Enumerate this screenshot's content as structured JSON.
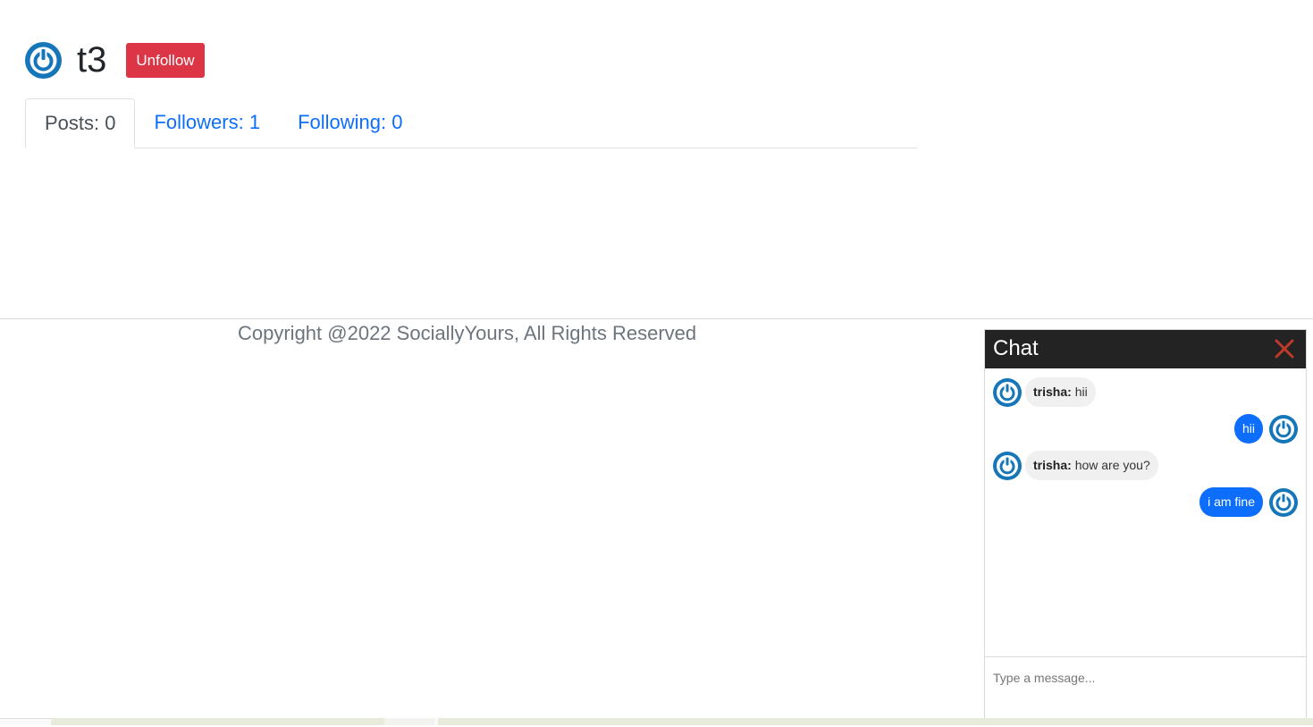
{
  "profile": {
    "name": "t3",
    "unfollow_label": "Unfollow"
  },
  "tabs": [
    {
      "label": "Posts: 0",
      "active": true
    },
    {
      "label": "Followers: 1",
      "active": false
    },
    {
      "label": "Following: 0",
      "active": false
    }
  ],
  "footer": {
    "copyright": "Copyright @2022 SociallyYours, All Rights Reserved"
  },
  "chat": {
    "title": "Chat",
    "close_icon": "close-x-icon",
    "messages": [
      {
        "direction": "incoming",
        "sender": "trisha:",
        "text": "hii"
      },
      {
        "direction": "outgoing",
        "text": "hii"
      },
      {
        "direction": "incoming",
        "sender": "trisha:",
        "text": "how are you?"
      },
      {
        "direction": "outgoing",
        "text": "i am fine"
      }
    ],
    "input_placeholder": "Type a message..."
  },
  "colors": {
    "accent_blue": "#0d6efd",
    "avatar_blue": "#1577b9",
    "danger_red": "#dc3545",
    "chat_header": "#232323",
    "close_red": "#c0392b"
  }
}
